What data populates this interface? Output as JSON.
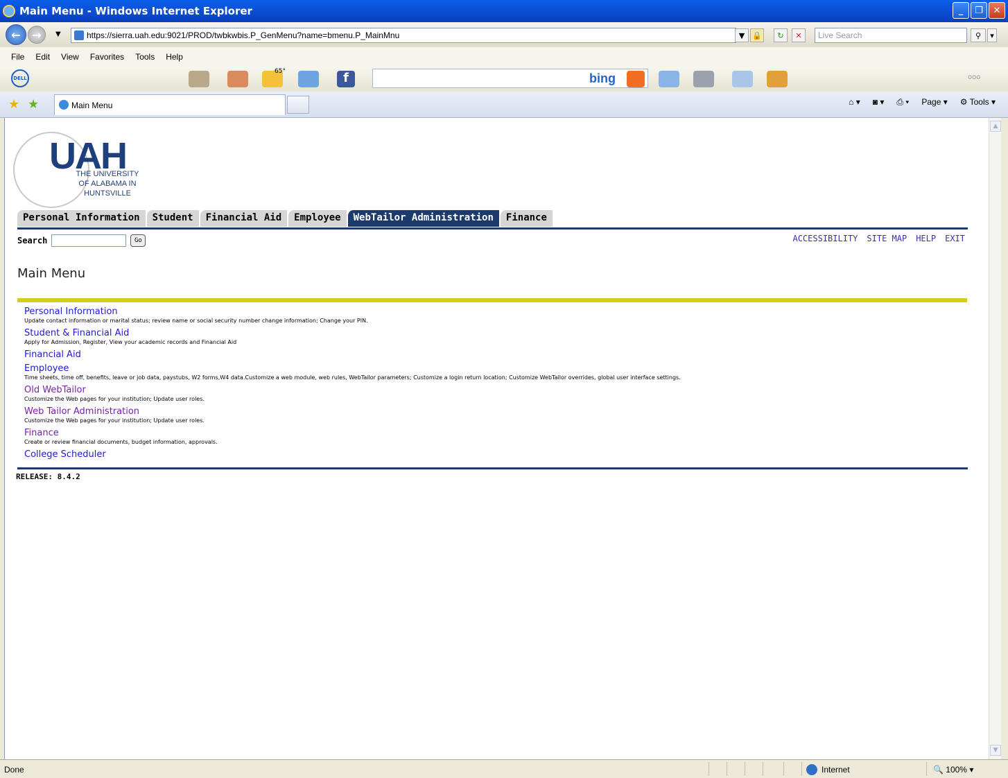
{
  "window": {
    "title": "Main Menu - Windows Internet Explorer"
  },
  "address": {
    "url": "https://sierra.uah.edu:9021/PROD/twbkwbis.P_GenMenu?name=bmenu.P_MainMnu",
    "search_placeholder": "Live Search"
  },
  "menubar": [
    "File",
    "Edit",
    "View",
    "Favorites",
    "Tools",
    "Help"
  ],
  "toolbar": {
    "weather": "65°",
    "bing": "bing"
  },
  "tabs": {
    "active_label": "Main Menu"
  },
  "commandbar": {
    "page": "Page",
    "tools": "Tools"
  },
  "page": {
    "logo": {
      "abbr": "UAH",
      "name_line1": "THE UNIVERSITY",
      "name_line2": "OF ALABAMA IN",
      "name_line3": "HUNTSVILLE"
    },
    "nav_tabs": [
      "Personal Information",
      "Student",
      "Financial Aid",
      "Employee",
      "WebTailor Administration",
      "Finance"
    ],
    "active_tab_index": 4,
    "search_label": "Search",
    "go_label": "Go",
    "top_links": [
      "ACCESSIBILITY",
      "SITE MAP",
      "HELP",
      "EXIT"
    ],
    "title": "Main Menu",
    "menu_items": [
      {
        "label": "Personal Information",
        "desc": "Update contact information or marital status; review name or social security number change information; Change your PIN."
      },
      {
        "label": "Student & Financial Aid",
        "desc": "Apply for Admission, Register, View your academic records and Financial Aid"
      },
      {
        "label": "Financial Aid",
        "desc": ""
      },
      {
        "label": "Employee",
        "desc": "Time sheets, time off, benefits, leave or job data, paystubs, W2 forms,W4 data.Customize a web module, web rules, WebTailor parameters; Customize a login return location; Customize WebTailor overrides, global user interface settings."
      },
      {
        "label": "Old WebTailor",
        "desc": "Customize the Web pages for your institution; Update user roles."
      },
      {
        "label": "Web Tailor Administration",
        "desc": "Customize the Web pages for your institution; Update user roles."
      },
      {
        "label": "Finance",
        "desc": "Create or review financial documents, budget information, approvals."
      },
      {
        "label": "College Scheduler",
        "desc": ""
      }
    ],
    "release": "RELEASE: 8.4.2"
  },
  "status": {
    "text": "Done",
    "zone": "Internet",
    "zoom": "100%"
  },
  "colors": {
    "nav_active": "#1c3a6b",
    "gold_rule": "#d6cc1a",
    "link": "#1f1ad2"
  }
}
